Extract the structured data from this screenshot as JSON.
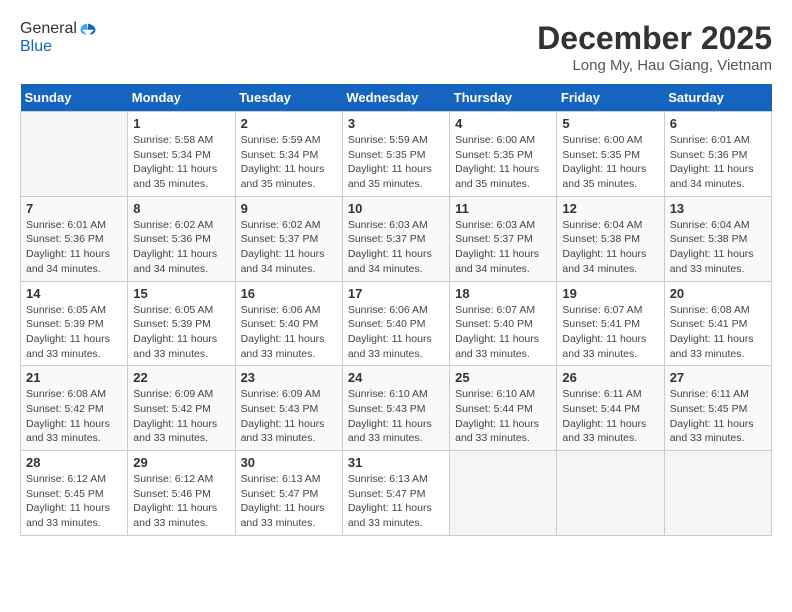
{
  "header": {
    "logo_general": "General",
    "logo_blue": "Blue",
    "month_title": "December 2025",
    "location": "Long My, Hau Giang, Vietnam"
  },
  "days_of_week": [
    "Sunday",
    "Monday",
    "Tuesday",
    "Wednesday",
    "Thursday",
    "Friday",
    "Saturday"
  ],
  "weeks": [
    [
      {
        "day": "",
        "info": ""
      },
      {
        "day": "1",
        "info": "Sunrise: 5:58 AM\nSunset: 5:34 PM\nDaylight: 11 hours\nand 35 minutes."
      },
      {
        "day": "2",
        "info": "Sunrise: 5:59 AM\nSunset: 5:34 PM\nDaylight: 11 hours\nand 35 minutes."
      },
      {
        "day": "3",
        "info": "Sunrise: 5:59 AM\nSunset: 5:35 PM\nDaylight: 11 hours\nand 35 minutes."
      },
      {
        "day": "4",
        "info": "Sunrise: 6:00 AM\nSunset: 5:35 PM\nDaylight: 11 hours\nand 35 minutes."
      },
      {
        "day": "5",
        "info": "Sunrise: 6:00 AM\nSunset: 5:35 PM\nDaylight: 11 hours\nand 35 minutes."
      },
      {
        "day": "6",
        "info": "Sunrise: 6:01 AM\nSunset: 5:36 PM\nDaylight: 11 hours\nand 34 minutes."
      }
    ],
    [
      {
        "day": "7",
        "info": "Sunrise: 6:01 AM\nSunset: 5:36 PM\nDaylight: 11 hours\nand 34 minutes."
      },
      {
        "day": "8",
        "info": "Sunrise: 6:02 AM\nSunset: 5:36 PM\nDaylight: 11 hours\nand 34 minutes."
      },
      {
        "day": "9",
        "info": "Sunrise: 6:02 AM\nSunset: 5:37 PM\nDaylight: 11 hours\nand 34 minutes."
      },
      {
        "day": "10",
        "info": "Sunrise: 6:03 AM\nSunset: 5:37 PM\nDaylight: 11 hours\nand 34 minutes."
      },
      {
        "day": "11",
        "info": "Sunrise: 6:03 AM\nSunset: 5:37 PM\nDaylight: 11 hours\nand 34 minutes."
      },
      {
        "day": "12",
        "info": "Sunrise: 6:04 AM\nSunset: 5:38 PM\nDaylight: 11 hours\nand 34 minutes."
      },
      {
        "day": "13",
        "info": "Sunrise: 6:04 AM\nSunset: 5:38 PM\nDaylight: 11 hours\nand 33 minutes."
      }
    ],
    [
      {
        "day": "14",
        "info": "Sunrise: 6:05 AM\nSunset: 5:39 PM\nDaylight: 11 hours\nand 33 minutes."
      },
      {
        "day": "15",
        "info": "Sunrise: 6:05 AM\nSunset: 5:39 PM\nDaylight: 11 hours\nand 33 minutes."
      },
      {
        "day": "16",
        "info": "Sunrise: 6:06 AM\nSunset: 5:40 PM\nDaylight: 11 hours\nand 33 minutes."
      },
      {
        "day": "17",
        "info": "Sunrise: 6:06 AM\nSunset: 5:40 PM\nDaylight: 11 hours\nand 33 minutes."
      },
      {
        "day": "18",
        "info": "Sunrise: 6:07 AM\nSunset: 5:40 PM\nDaylight: 11 hours\nand 33 minutes."
      },
      {
        "day": "19",
        "info": "Sunrise: 6:07 AM\nSunset: 5:41 PM\nDaylight: 11 hours\nand 33 minutes."
      },
      {
        "day": "20",
        "info": "Sunrise: 6:08 AM\nSunset: 5:41 PM\nDaylight: 11 hours\nand 33 minutes."
      }
    ],
    [
      {
        "day": "21",
        "info": "Sunrise: 6:08 AM\nSunset: 5:42 PM\nDaylight: 11 hours\nand 33 minutes."
      },
      {
        "day": "22",
        "info": "Sunrise: 6:09 AM\nSunset: 5:42 PM\nDaylight: 11 hours\nand 33 minutes."
      },
      {
        "day": "23",
        "info": "Sunrise: 6:09 AM\nSunset: 5:43 PM\nDaylight: 11 hours\nand 33 minutes."
      },
      {
        "day": "24",
        "info": "Sunrise: 6:10 AM\nSunset: 5:43 PM\nDaylight: 11 hours\nand 33 minutes."
      },
      {
        "day": "25",
        "info": "Sunrise: 6:10 AM\nSunset: 5:44 PM\nDaylight: 11 hours\nand 33 minutes."
      },
      {
        "day": "26",
        "info": "Sunrise: 6:11 AM\nSunset: 5:44 PM\nDaylight: 11 hours\nand 33 minutes."
      },
      {
        "day": "27",
        "info": "Sunrise: 6:11 AM\nSunset: 5:45 PM\nDaylight: 11 hours\nand 33 minutes."
      }
    ],
    [
      {
        "day": "28",
        "info": "Sunrise: 6:12 AM\nSunset: 5:45 PM\nDaylight: 11 hours\nand 33 minutes."
      },
      {
        "day": "29",
        "info": "Sunrise: 6:12 AM\nSunset: 5:46 PM\nDaylight: 11 hours\nand 33 minutes."
      },
      {
        "day": "30",
        "info": "Sunrise: 6:13 AM\nSunset: 5:47 PM\nDaylight: 11 hours\nand 33 minutes."
      },
      {
        "day": "31",
        "info": "Sunrise: 6:13 AM\nSunset: 5:47 PM\nDaylight: 11 hours\nand 33 minutes."
      },
      {
        "day": "",
        "info": ""
      },
      {
        "day": "",
        "info": ""
      },
      {
        "day": "",
        "info": ""
      }
    ]
  ]
}
